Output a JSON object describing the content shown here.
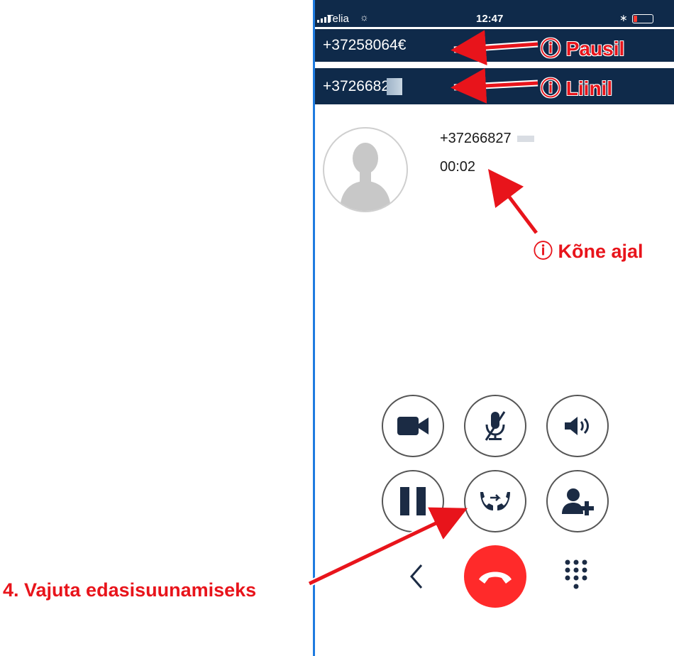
{
  "status_bar": {
    "carrier": "Telia",
    "time": "12:47"
  },
  "calls": {
    "held_number": "+37258064€",
    "active_number": "+3726682"
  },
  "contact": {
    "number": "+37266827",
    "duration": "00:02"
  },
  "annotations": {
    "held_label": "ⓘ Pausil",
    "active_label": "ⓘ Liinil",
    "during_call_label": "ⓘ Kõne ajal",
    "instruction": "4. Vajuta edasisuunamiseks"
  },
  "colors": {
    "header_bg": "#0f2a4a",
    "annotation_red": "#e8141b",
    "end_call_red": "#ff2a2a",
    "phone_border": "#1e7be0"
  },
  "icons": [
    "video-icon",
    "mute-mic-icon",
    "speaker-icon",
    "pause-icon",
    "transfer-call-icon",
    "add-participant-icon",
    "back-chevron-icon",
    "end-call-icon",
    "keypad-icon"
  ]
}
